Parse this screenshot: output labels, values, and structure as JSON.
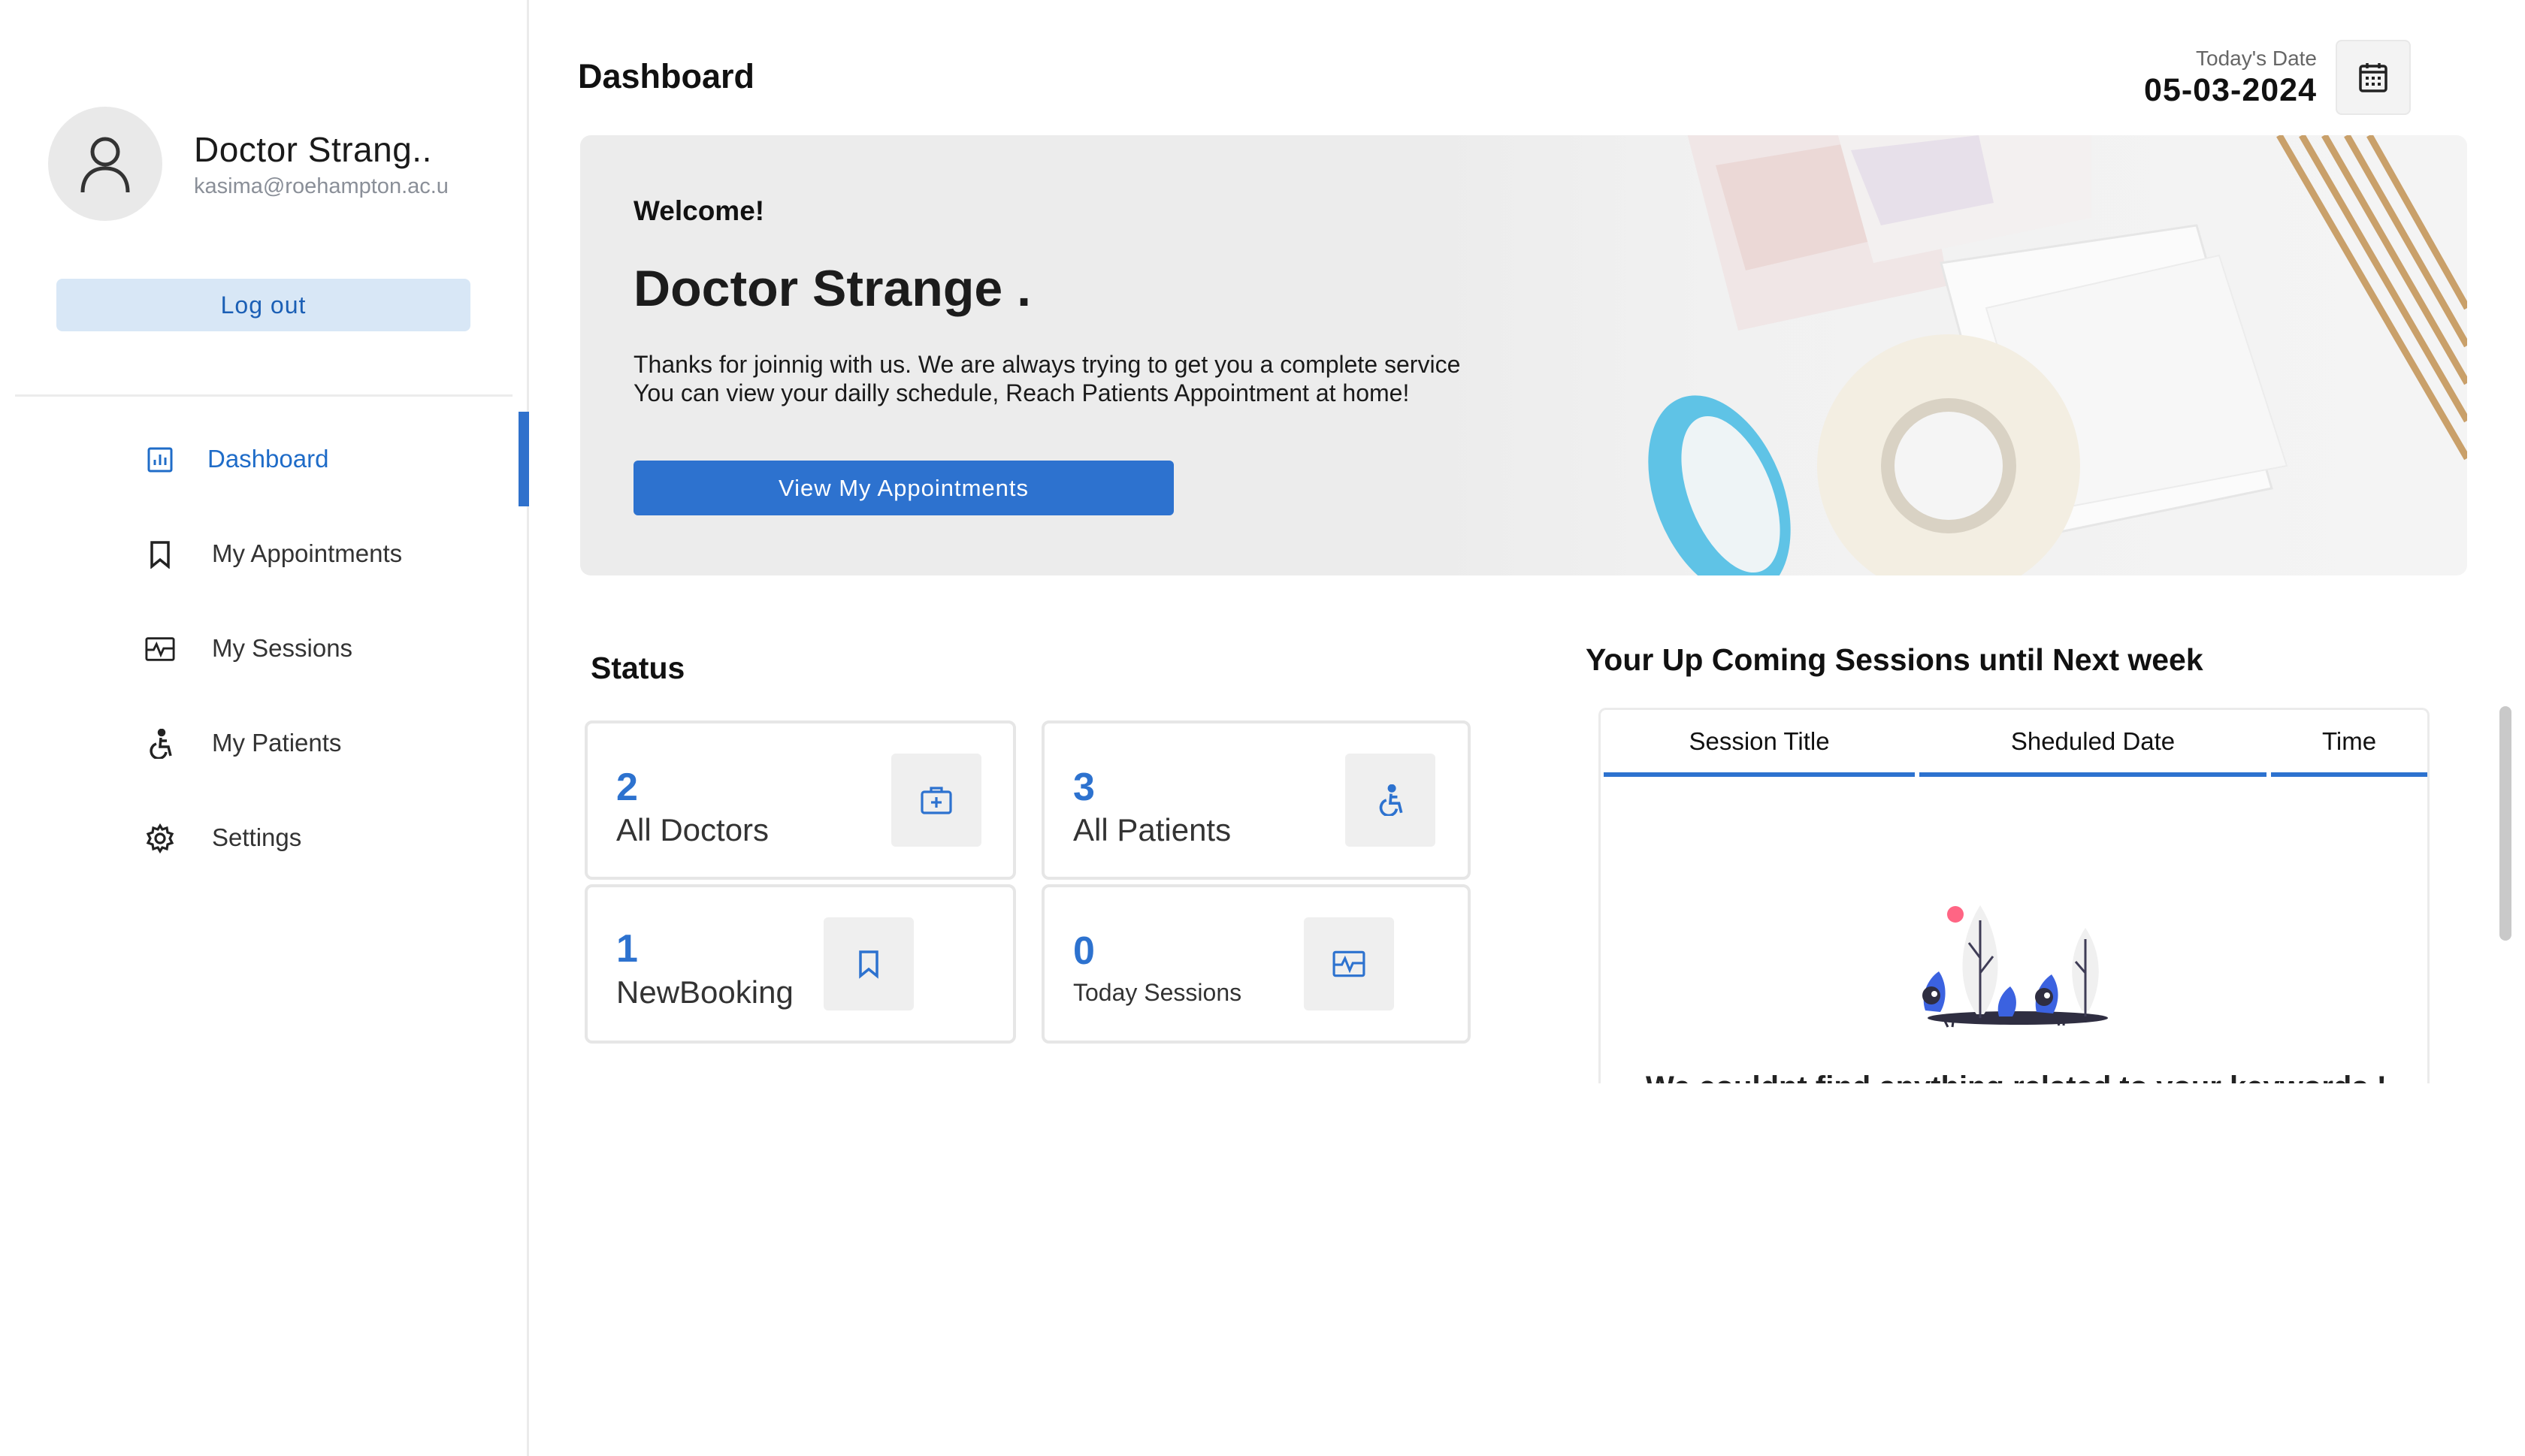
{
  "sidebar": {
    "profile": {
      "name": "Doctor Strang..",
      "email": "kasima@roehampton.ac.u"
    },
    "logout_label": "Log out",
    "nav": [
      {
        "label": "Dashboard",
        "icon": "chart-bar-icon",
        "active": true
      },
      {
        "label": "My Appointments",
        "icon": "bookmark-icon",
        "active": false
      },
      {
        "label": "My Sessions",
        "icon": "session-pulse-icon",
        "active": false
      },
      {
        "label": "My Patients",
        "icon": "accessible-person-icon",
        "active": false
      },
      {
        "label": "Settings",
        "icon": "gear-icon",
        "active": false
      }
    ]
  },
  "header": {
    "title": "Dashboard",
    "date_label": "Today's Date",
    "date_value": "05-03-2024"
  },
  "banner": {
    "welcome": "Welcome!",
    "name": "Doctor Strange .",
    "description_line1": "Thanks for joinnig with us. We are always trying to get you a complete service",
    "description_line2": "You can view your dailly schedule, Reach Patients Appointment at home!",
    "button_label": "View My Appointments"
  },
  "status": {
    "title": "Status",
    "cards": [
      {
        "count": "2",
        "label": "All Doctors",
        "icon": "medical-kit-icon"
      },
      {
        "count": "3",
        "label": "All Patients",
        "icon": "accessible-person-icon"
      },
      {
        "count": "1",
        "label": "NewBooking",
        "icon": "bookmark-icon"
      },
      {
        "count": "0",
        "label": "Today Sessions",
        "icon": "session-pulse-icon"
      }
    ]
  },
  "sessions": {
    "title": "Your Up Coming Sessions until Next week",
    "columns": [
      "Session Title",
      "Sheduled Date",
      "Time"
    ],
    "empty_message": "We couldnt find anything related to your keywords !"
  },
  "colors": {
    "accent": "#2d72cf",
    "accent_light": "#d8e7f6",
    "card_border": "#e6e6e6"
  }
}
